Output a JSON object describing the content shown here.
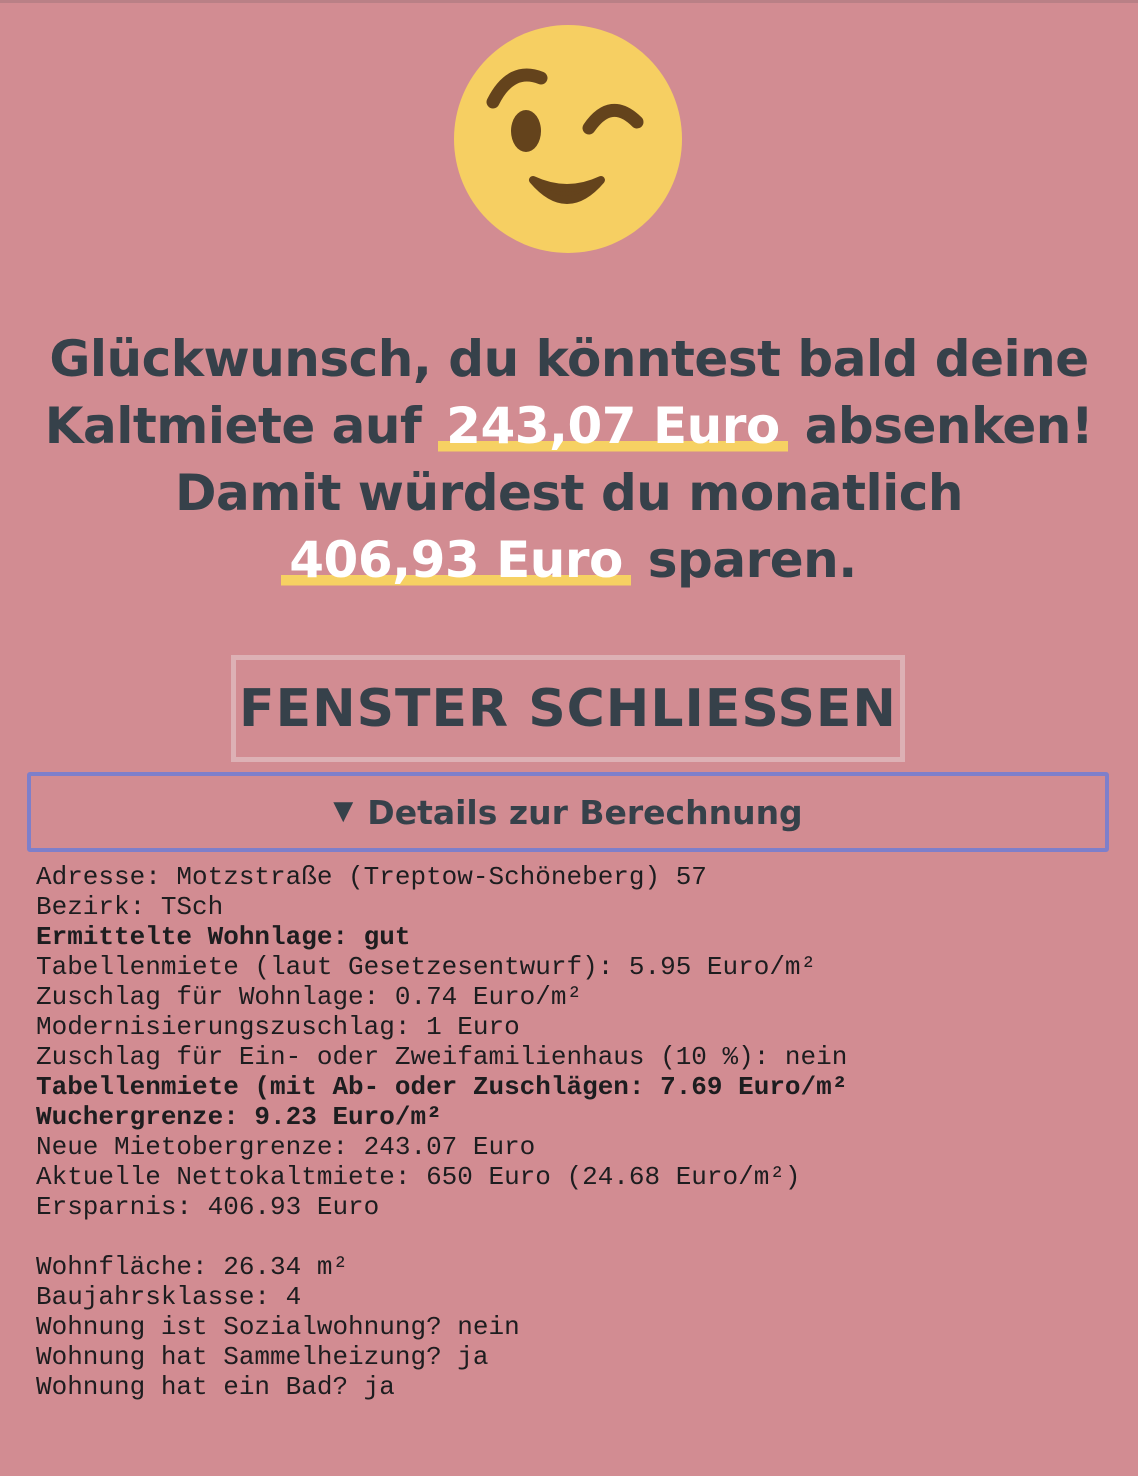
{
  "emoji": "winking-face",
  "headline": {
    "line1": "Glückwunsch, du könntest bald deine",
    "line2_pre": "Kaltmiete auf ",
    "new_rent": "243,07 Euro",
    "line2_post": " absenken!",
    "line3": "Damit würdest du monatlich",
    "savings": "406,93 Euro",
    "line4_post": " sparen."
  },
  "close_button": {
    "label": "FENSTER SCHLIESSEN"
  },
  "details": {
    "toggle_icon": "▼",
    "summary": "Details zur Berechnung",
    "lines": [
      "Adresse: Motzstraße (Treptow-Schöneberg) 57",
      "Bezirk: TSch",
      "Ermittelte Wohnlage: gut",
      "Tabellenmiete (laut Gesetzesentwurf): 5.95 Euro/m²",
      "Zuschlag für Wohnlage: 0.74 Euro/m²",
      "Modernisierungszuschlag: 1 Euro",
      "Zuschlag für Ein- oder Zweifamilienhaus (10 %): nein",
      "Tabellenmiete (mit Ab- oder Zuschlägen: 7.69 Euro/m²",
      "Wuchergrenze: 9.23 Euro/m²",
      "Neue Mietobergrenze: 243.07 Euro",
      "Aktuelle Nettokaltmiete: 650 Euro (24.68 Euro/m²)",
      "Ersparnis: 406.93 Euro",
      "Wohnfläche: 26.34 m²",
      "Baujahrsklasse: 4",
      "Wohnung ist Sozialwohnung? nein",
      "Wohnung hat Sammelheizung? ja",
      "Wohnung hat ein Bad? ja"
    ]
  },
  "colors": {
    "background": "#d28c92",
    "text_dark": "#36414a",
    "highlight": "#f6d163",
    "emoji_face": "#f6cf62",
    "emoji_features": "#64431c",
    "summary_border": "#7e7fca"
  }
}
